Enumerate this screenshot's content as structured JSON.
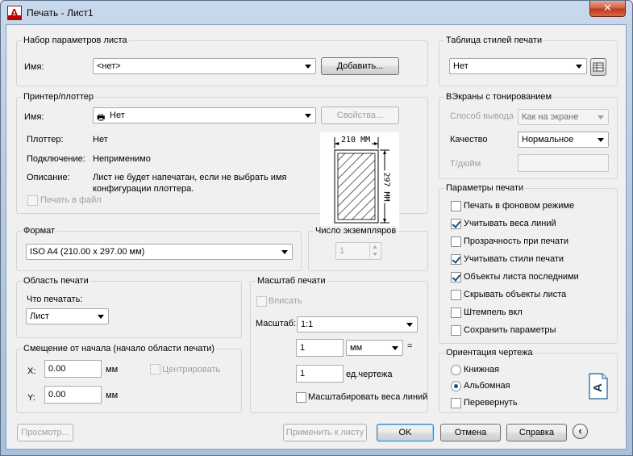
{
  "window": {
    "title": "Печать - Лист1",
    "app_icon_letter": "A",
    "close_glyph": "✕"
  },
  "page_setup": {
    "legend": "Набор параметров листа",
    "name_label": "Имя:",
    "name_value": "<нет>",
    "add_button": "Добавить..."
  },
  "printer": {
    "legend": "Принтер/плоттер",
    "name_label": "Имя:",
    "name_value": "Нет",
    "properties_button": "Свойства...",
    "plotter_label": "Плоттер:",
    "plotter_value": "Нет",
    "connection_label": "Подключение:",
    "connection_value": "Неприменимо",
    "description_label": "Описание:",
    "description_line1": "Лист не будет напечатан, если не выбрать имя",
    "description_line2": "конфигурации плоттера.",
    "print_to_file_label": "Печать в файл",
    "print_to_file_checked": false,
    "paper_width": "210 MM",
    "paper_height": "297 MM"
  },
  "format": {
    "legend": "Формат",
    "value": "ISO A4 (210.00 x 297.00 мм)"
  },
  "copies": {
    "legend": "Число экземпляров",
    "value": "1"
  },
  "plot_area": {
    "legend": "Область печати",
    "what_label": "Что печатать:",
    "what_value": "Лист"
  },
  "offset": {
    "legend": "Смещение от начала (начало области печати)",
    "x_label": "X:",
    "x_value": "0.00",
    "x_unit": "мм",
    "y_label": "Y:",
    "y_value": "0.00",
    "y_unit": "мм",
    "center_label": "Центрировать",
    "center_checked": false
  },
  "scale": {
    "legend": "Масштаб печати",
    "fit_label": "Вписать",
    "fit_checked": false,
    "scale_label": "Масштаб:",
    "scale_value": "1:1",
    "value1": "1",
    "unit1": "мм",
    "equals": "=",
    "value2": "1",
    "unit2": "ед.чертежа",
    "lineweights_label": "Масштабировать веса линий",
    "lineweights_checked": false
  },
  "style_table": {
    "legend": "Таблица стилей печати",
    "value": "Нет",
    "edit_icon": "edit-table-icon"
  },
  "shaded": {
    "legend": "ВЭкраны с тонированием",
    "mode_label": "Способ вывода",
    "mode_value": "Как на экране",
    "quality_label": "Качество",
    "quality_value": "Нормальное",
    "dpi_label": "Т/дюйм",
    "dpi_value": ""
  },
  "options": {
    "legend": "Параметры печати",
    "items": [
      {
        "label": "Печать в фоновом режиме",
        "checked": false
      },
      {
        "label": "Учитывать веса линий",
        "checked": true
      },
      {
        "label": "Прозрачность при печати",
        "checked": false
      },
      {
        "label": "Учитывать стили печати",
        "checked": true
      },
      {
        "label": "Объекты листа последними",
        "checked": true
      },
      {
        "label": "Скрывать объекты листа",
        "checked": false
      },
      {
        "label": "Штемпель вкл",
        "checked": false
      },
      {
        "label": "Сохранить параметры",
        "checked": false
      }
    ]
  },
  "orientation": {
    "legend": "Ориентация чертежа",
    "portrait": "Книжная",
    "landscape": "Альбомная",
    "upside_down": "Перевернуть",
    "selected": "landscape",
    "upside_down_checked": false,
    "orientation_icon_letter": "A"
  },
  "footer": {
    "preview": "Просмотр...",
    "apply": "Применить к листу",
    "ok": "OK",
    "cancel": "Отмена",
    "help": "Справка",
    "collapse_glyph": "‹"
  },
  "colors": {
    "title_bg": "#b7cbe3",
    "client_bg": "#f0f0f0",
    "close_red": "#c2381d",
    "check_blue": "#1a4f87"
  }
}
